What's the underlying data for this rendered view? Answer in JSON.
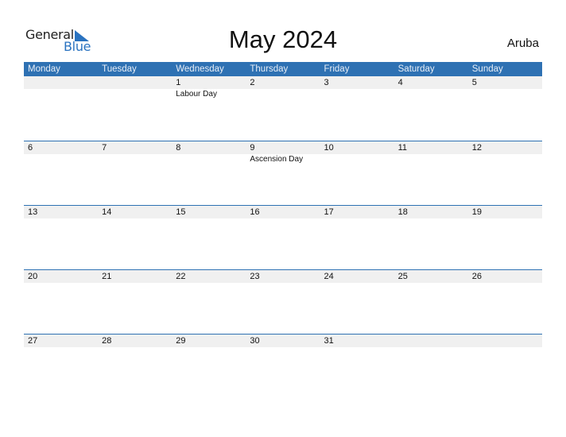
{
  "logo": {
    "word1": "General",
    "word2": "Blue",
    "accent": "#2a73c0"
  },
  "title": "May 2024",
  "country": "Aruba",
  "colors": {
    "header_bg": "#2e71b3",
    "band_bg": "#f0f0f0"
  },
  "weekdays": [
    "Monday",
    "Tuesday",
    "Wednesday",
    "Thursday",
    "Friday",
    "Saturday",
    "Sunday"
  ],
  "weeks": [
    [
      {
        "day": ""
      },
      {
        "day": ""
      },
      {
        "day": "1",
        "event": "Labour Day"
      },
      {
        "day": "2"
      },
      {
        "day": "3"
      },
      {
        "day": "4"
      },
      {
        "day": "5"
      }
    ],
    [
      {
        "day": "6"
      },
      {
        "day": "7"
      },
      {
        "day": "8"
      },
      {
        "day": "9",
        "event": "Ascension Day"
      },
      {
        "day": "10"
      },
      {
        "day": "11"
      },
      {
        "day": "12"
      }
    ],
    [
      {
        "day": "13"
      },
      {
        "day": "14"
      },
      {
        "day": "15"
      },
      {
        "day": "16"
      },
      {
        "day": "17"
      },
      {
        "day": "18"
      },
      {
        "day": "19"
      }
    ],
    [
      {
        "day": "20"
      },
      {
        "day": "21"
      },
      {
        "day": "22"
      },
      {
        "day": "23"
      },
      {
        "day": "24"
      },
      {
        "day": "25"
      },
      {
        "day": "26"
      }
    ],
    [
      {
        "day": "27"
      },
      {
        "day": "28"
      },
      {
        "day": "29"
      },
      {
        "day": "30"
      },
      {
        "day": "31"
      },
      {
        "day": ""
      },
      {
        "day": ""
      }
    ]
  ]
}
